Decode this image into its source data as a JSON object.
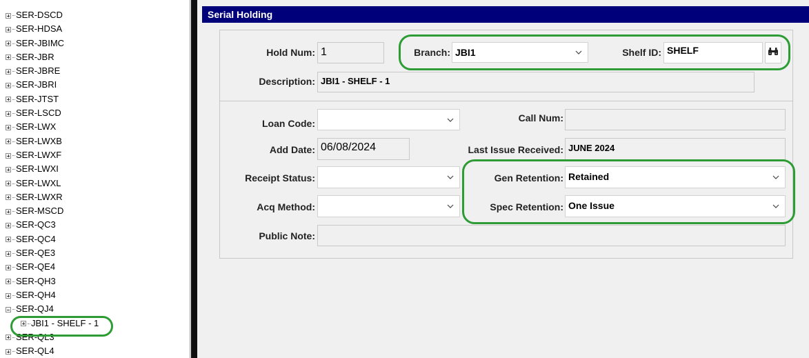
{
  "tree": {
    "items": [
      {
        "label": "SER-DSCD",
        "expanded": false
      },
      {
        "label": "SER-HDSA",
        "expanded": false
      },
      {
        "label": "SER-JBIMC",
        "expanded": false
      },
      {
        "label": "SER-JBR",
        "expanded": false
      },
      {
        "label": "SER-JBRE",
        "expanded": false
      },
      {
        "label": "SER-JBRI",
        "expanded": false
      },
      {
        "label": "SER-JTST",
        "expanded": false
      },
      {
        "label": "SER-LSCD",
        "expanded": false
      },
      {
        "label": "SER-LWX",
        "expanded": false
      },
      {
        "label": "SER-LWXB",
        "expanded": false
      },
      {
        "label": "SER-LWXF",
        "expanded": false
      },
      {
        "label": "SER-LWXI",
        "expanded": false
      },
      {
        "label": "SER-LWXL",
        "expanded": false
      },
      {
        "label": "SER-LWXR",
        "expanded": false
      },
      {
        "label": "SER-MSCD",
        "expanded": false
      },
      {
        "label": "SER-QC3",
        "expanded": false
      },
      {
        "label": "SER-QC4",
        "expanded": false
      },
      {
        "label": "SER-QE3",
        "expanded": false
      },
      {
        "label": "SER-QE4",
        "expanded": false
      },
      {
        "label": "SER-QH3",
        "expanded": false
      },
      {
        "label": "SER-QH4",
        "expanded": false
      },
      {
        "label": "SER-QJ4",
        "expanded": true
      },
      {
        "label": "JBI1 - SHELF - 1",
        "expanded": false,
        "child": true,
        "selected": true
      },
      {
        "label": "SER-QL3",
        "expanded": false
      },
      {
        "label": "SER-QL4",
        "expanded": false
      }
    ]
  },
  "panel": {
    "title": "Serial Holding",
    "hold_num_label": "Hold Num:",
    "hold_num_value": "1",
    "branch_label": "Branch:",
    "branch_value": "JBI1",
    "shelf_id_label": "Shelf ID:",
    "shelf_id_value": "SHELF",
    "description_label": "Description:",
    "description_value": "JBI1 - SHELF - 1",
    "loan_code_label": "Loan Code:",
    "loan_code_value": "",
    "call_num_label": "Call Num:",
    "call_num_value": "",
    "add_date_label": "Add Date:",
    "add_date_value": "06/08/2024",
    "last_issue_label": "Last Issue Received:",
    "last_issue_value": "JUNE 2024",
    "receipt_status_label": "Receipt Status:",
    "receipt_status_value": "",
    "gen_retention_label": "Gen Retention:",
    "gen_retention_value": "Retained",
    "acq_method_label": "Acq Method:",
    "acq_method_value": "",
    "spec_retention_label": "Spec Retention:",
    "spec_retention_value": "One Issue",
    "public_note_label": "Public Note:",
    "public_note_value": ""
  },
  "icons": {
    "search": "binoculars-icon",
    "dropdown": "chevron-down-icon",
    "tree_expand": "plus-box-icon",
    "tree_collapse": "minus-box-icon"
  },
  "colors": {
    "title_bar": "#00007a",
    "highlight": "#2e9c35",
    "splitter": "#101010"
  }
}
